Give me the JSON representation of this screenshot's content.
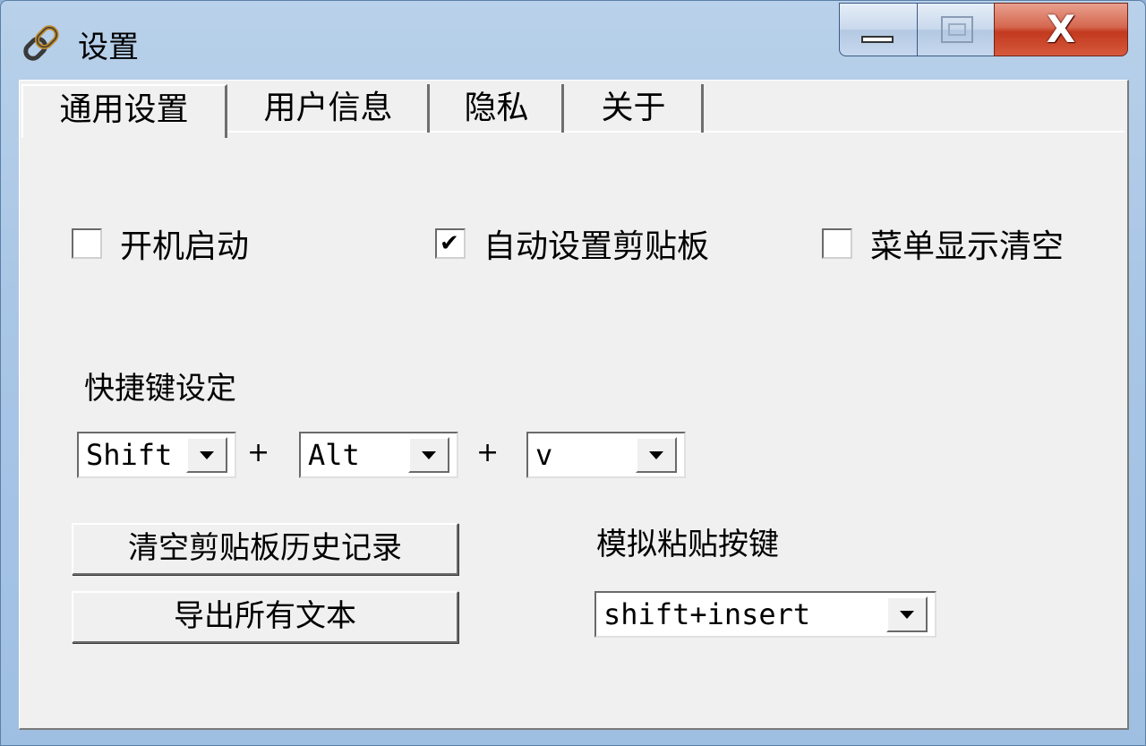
{
  "window": {
    "title": "设置",
    "icon": "link-chain-icon",
    "close_glyph": "X"
  },
  "tabs": [
    {
      "label": "通用设置",
      "active": true
    },
    {
      "label": "用户信息",
      "active": false
    },
    {
      "label": "隐私",
      "active": false
    },
    {
      "label": "关于",
      "active": false
    }
  ],
  "general": {
    "checkboxes": [
      {
        "label": "开机启动",
        "checked": false
      },
      {
        "label": "自动设置剪贴板",
        "checked": true
      },
      {
        "label": "菜单显示清空",
        "checked": false
      }
    ],
    "check_mark": "✔",
    "hotkey_label": "快捷键设定",
    "hotkey": {
      "modifier1": "Shift",
      "modifier2": "Alt",
      "key": "v",
      "plus": "+"
    },
    "buttons": {
      "clear_history": "清空剪贴板历史记录",
      "export_all": "导出所有文本"
    },
    "paste_key_label": "模拟粘贴按键",
    "paste_key_value": "shift+insert"
  }
}
